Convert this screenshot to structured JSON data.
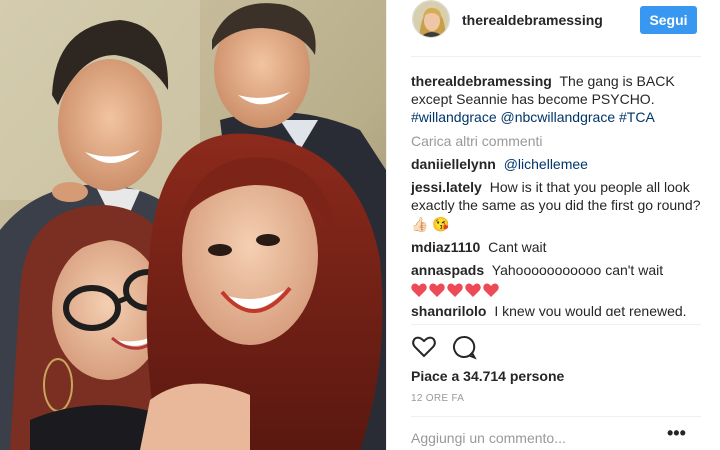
{
  "header": {
    "username": "therealdebramessing",
    "follow_label": "Segui"
  },
  "caption": {
    "username": "therealdebramessing",
    "text": "The gang is BACK except Seannie has become PSYCHO.",
    "hashtags": [
      "#willandgrace",
      "@nbcwillandgrace",
      "#TCA"
    ]
  },
  "load_more": "Carica altri commenti",
  "comments": [
    {
      "username": "daniiellelynn",
      "text": "",
      "mention": "@lichellemee"
    },
    {
      "username": "jessi.lately",
      "text": "How is it that you people all look exactly the same as you did the first go round?",
      "emoji": "👍🏻 😘"
    },
    {
      "username": "mdiaz1110",
      "text": "Cant wait"
    },
    {
      "username": "annaspads",
      "text": "Yahooooooooooo can't wait",
      "hearts": 5,
      "heart_color": "#ed4956"
    },
    {
      "username": "shangrilolo",
      "text": "I knew you would get renewed."
    }
  ],
  "actions": {
    "like_icon": "heart-outline-icon",
    "comment_icon": "comment-bubble-icon"
  },
  "likes": "Piace a 34.714 persone",
  "time": "12 ORE FA",
  "add_comment_placeholder": "Aggiungi un commento...",
  "more_icon": "ellipsis-icon",
  "colors": {
    "accent": "#3897f0",
    "link": "#003569",
    "muted": "#999999",
    "heart": "#ed4956"
  }
}
